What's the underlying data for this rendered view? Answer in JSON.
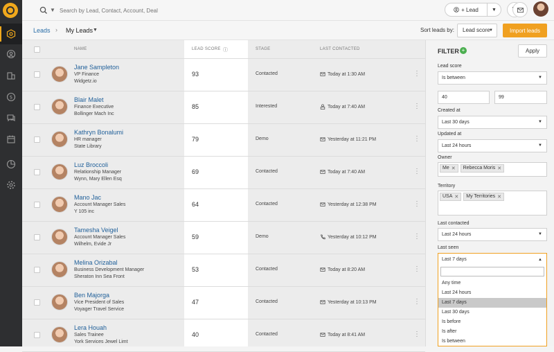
{
  "search": {
    "placeholder": "Search by Lead, Contact, Account, Deal"
  },
  "topbar": {
    "lead_button_label": "+ Lead"
  },
  "breadcrumb": {
    "root": "Leads",
    "separator": "›",
    "current": "My Leads"
  },
  "sort": {
    "label": "Sort leads by:",
    "value": "Lead score"
  },
  "import_label": "Import leads",
  "table": {
    "headers": {
      "name": "NAME",
      "score": "LEAD SCORE",
      "stage": "STAGE",
      "last_contacted": "LAST CONTACTED"
    },
    "rows": [
      {
        "name": "Jane Sampleton",
        "title": "VP Finance",
        "company": "Widgetz.io",
        "score": "93",
        "stage": "Contacted",
        "contact_icon": "email-icon",
        "last_contacted": "Today at 1:30 AM"
      },
      {
        "name": "Blair Malet",
        "title": "Finance Executive",
        "company": "Bollinger Mach Inc",
        "score": "85",
        "stage": "Interested",
        "contact_icon": "meeting-icon",
        "last_contacted": "Today at 7:40 AM"
      },
      {
        "name": "Kathryn Bonalumi",
        "title": "HR manager",
        "company": "State Library",
        "score": "79",
        "stage": "Demo",
        "contact_icon": "email-icon",
        "last_contacted": "Yesterday at 11:21 PM"
      },
      {
        "name": "Luz Broccoli",
        "title": "Relationship Manager",
        "company": "Wynn, Mary Ellen Esq",
        "score": "69",
        "stage": "Contacted",
        "contact_icon": "email-icon",
        "last_contacted": "Today at 7:40 AM"
      },
      {
        "name": "Mano Jac",
        "title": "Account Manager Sales",
        "company": "Y 105 inc",
        "score": "64",
        "stage": "Contacted",
        "contact_icon": "email-icon",
        "last_contacted": "Yesterday at 12:38 PM"
      },
      {
        "name": "Tamesha Veigel",
        "title": "Account Manager Sales",
        "company": "Wilhelm, Evide Jr",
        "score": "59",
        "stage": "Demo",
        "contact_icon": "phone-icon",
        "last_contacted": "Yesterday at 10:12 PM"
      },
      {
        "name": "Melina Orizabal",
        "title": "Business Development Manager",
        "company": "Sheraton Inn Sea Front",
        "score": "53",
        "stage": "Contacted",
        "contact_icon": "email-icon",
        "last_contacted": "Today at 8:20 AM"
      },
      {
        "name": "Ben Majorga",
        "title": "Vice President of Sales",
        "company": "Voyager Travel Service",
        "score": "47",
        "stage": "Contacted",
        "contact_icon": "email-icon",
        "last_contacted": "Yesterday at 10:13 PM"
      },
      {
        "name": "Lera Houah",
        "title": "Sales Trainee",
        "company": "York Services Jewel Limt",
        "score": "40",
        "stage": "Contacted",
        "contact_icon": "email-icon",
        "last_contacted": "Today at 8:41 AM"
      }
    ]
  },
  "filter": {
    "title": "FILTER",
    "apply_label": "Apply",
    "lead_score": {
      "label": "Lead score",
      "operator": "Is between",
      "min": "40",
      "max": "99"
    },
    "created_at": {
      "label": "Created at",
      "value": "Last 30 days"
    },
    "updated_at": {
      "label": "Updated at",
      "value": "Last 24 hours"
    },
    "owner": {
      "label": "Owner",
      "tags": [
        "Me",
        "Rebecca Moris"
      ]
    },
    "territory": {
      "label": "Territory",
      "tags": [
        "USA",
        "My Territories"
      ]
    },
    "last_contacted": {
      "label": "Last contacted",
      "value": "Last 24 hours"
    },
    "last_seen": {
      "label": "Last seen",
      "value": "Last 7 days",
      "options": [
        "Any time",
        "Last 24 hours",
        "Last 7 days",
        "Last 30 days",
        "Is before",
        "Is after",
        "Is between"
      ],
      "selected_index": 2
    }
  },
  "colors": {
    "accent": "#f0a020",
    "link": "#1f5f99",
    "sidebar": "#2e2f31"
  }
}
